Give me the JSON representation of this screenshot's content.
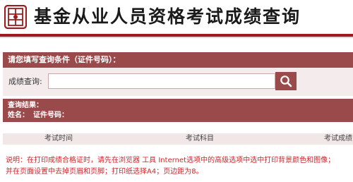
{
  "header": {
    "title": "基金从业人员资格考试成绩查询",
    "logo_icon": "bank-seal-logo-icon",
    "accent_color": "#9b1b1f"
  },
  "query": {
    "panel_title": "请您填写查询条件（证件号码）：",
    "label": "成绩查询:",
    "input_value": "",
    "search_icon": "search-icon"
  },
  "results": {
    "title": "查询结果：",
    "name_label": "姓名：",
    "id_label": "证件号码：",
    "columns": [
      "考试时间",
      "考试科目",
      "考试成绩"
    ]
  },
  "note": {
    "line1": "说明：在打印成绩合格证时，请先在浏览器 工具 Internet选项中的高级选项中选中打印背景颜色和图像；",
    "line2": "并在页面设置中去掉页眉和页脚；打印纸选择A4；页边距为8。"
  },
  "colors": {
    "bar": "#9b4a4c",
    "note": "#c8282c",
    "row_bg": "#f4ecec"
  }
}
